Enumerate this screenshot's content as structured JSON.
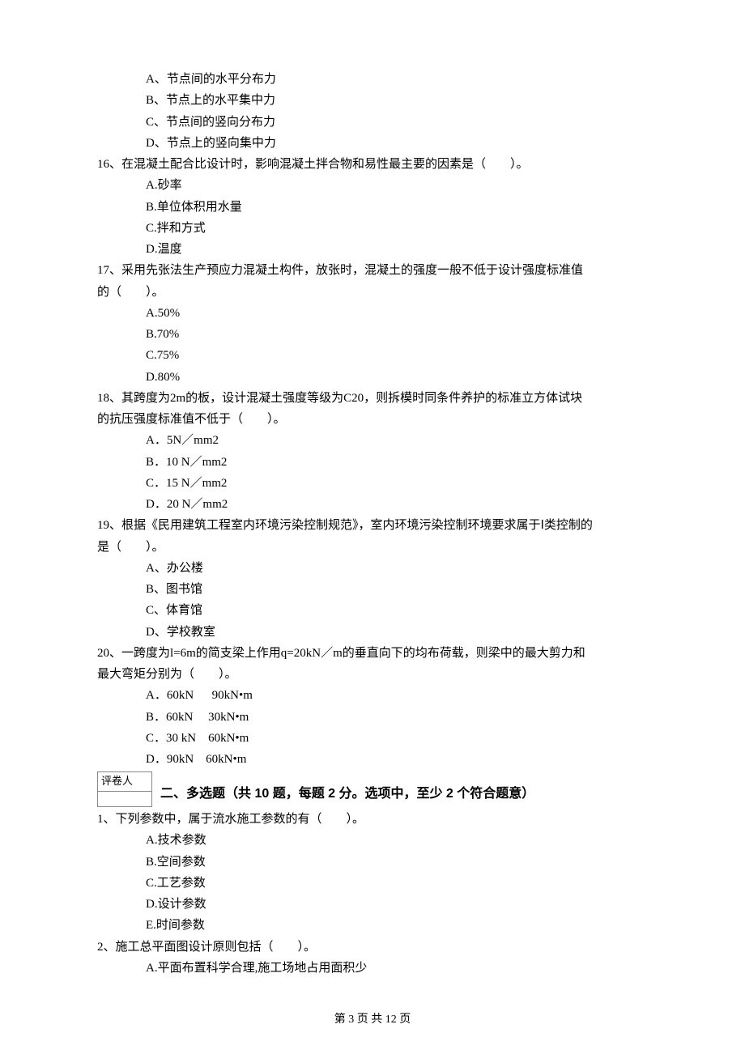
{
  "q15": {
    "optA": "A、节点间的水平分布力",
    "optB": "B、节点上的水平集中力",
    "optC": "C、节点间的竖向分布力",
    "optD": "D、节点上的竖向集中力"
  },
  "q16": {
    "stem": "16、在混凝土配合比设计时，影响混凝土拌合物和易性最主要的因素是（　　）。",
    "optA": "A.砂率",
    "optB": "B.单位体积用水量",
    "optC": "C.拌和方式",
    "optD": "D.温度"
  },
  "q17": {
    "stem1": "17、采用先张法生产预应力混凝土构件，放张时，混凝土的强度一般不低于设计强度标准值",
    "stem2": "的（　　）。",
    "optA": "A.50%",
    "optB": "B.70%",
    "optC": "C.75%",
    "optD": "D.80%"
  },
  "q18": {
    "stem1": "18、其跨度为2m的板，设计混凝土强度等级为C20，则拆模时同条件养护的标准立方体试块",
    "stem2": "的抗压强度标准值不低于（　　）。",
    "optA": "A．5N／mm2",
    "optB": "B．10 N／mm2",
    "optC": "C．15 N／mm2",
    "optD": "D．20 N／mm2"
  },
  "q19": {
    "stem1": "19、根据《民用建筑工程室内环境污染控制规范》，室内环境污染控制环境要求属于Ⅰ类控制的",
    "stem2": "是（　　）。",
    "optA": "A、办公楼",
    "optB": "B、图书馆",
    "optC": "C、体育馆",
    "optD": "D、学校教室"
  },
  "q20": {
    "stem1": "20、一跨度为l=6m的简支梁上作用q=20kN／m的垂直向下的均布荷载，则梁中的最大剪力和",
    "stem2": "最大弯矩分别为（　　）。",
    "optA": "A．60kN      90kN•m",
    "optB": "B．60kN     30kN•m",
    "optC": "C．30 kN    60kN•m",
    "optD": "D．90kN    60kN•m"
  },
  "grader_label": "评卷人",
  "section2_title": "二、多选题（共 10 题，每题 2 分。选项中，至少 2 个符合题意）",
  "mq1": {
    "stem": "1、下列参数中，属于流水施工参数的有（　　）。",
    "optA": "A.技术参数",
    "optB": "B.空间参数",
    "optC": "C.工艺参数",
    "optD": "D.设计参数",
    "optE": "E.时间参数"
  },
  "mq2": {
    "stem": "2、施工总平面图设计原则包括（　　）。",
    "optA": "A.平面布置科学合理,施工场地占用面积少"
  },
  "footer": "第 3 页 共 12 页"
}
